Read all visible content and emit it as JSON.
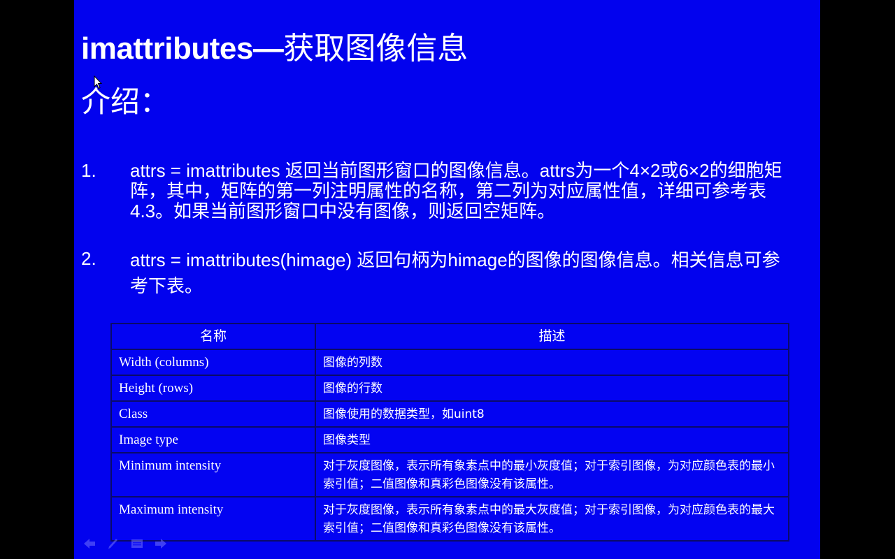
{
  "slide": {
    "title_en": "imattributes",
    "title_dash": "—",
    "title_zh": "获取图像信息",
    "subtitle": "介绍：",
    "items": [
      {
        "number": "1.",
        "code": "attrs = imattributes",
        "text": " 返回当前图形窗口的图像信息。attrs为一个4×2或6×2的细胞矩阵，其中，矩阵的第一列注明属性的名称，第二列为对应属性值，详细可参考表4.3。如果当前图形窗口中没有图像，则返回空矩阵。"
      },
      {
        "number": "2.",
        "code": "attrs = imattributes(himage)",
        "text": " 返回句柄为himage的图像的图像信息。相关信息可参考下表。"
      }
    ],
    "table": {
      "headers": [
        "名称",
        "描述"
      ],
      "rows": [
        {
          "name": "Width (columns)",
          "desc": "图像的列数"
        },
        {
          "name": "Height (rows)",
          "desc": "图像的行数"
        },
        {
          "name": "Class",
          "desc": "图像使用的数据类型，如uint8"
        },
        {
          "name": "Image type",
          "desc": "图像类型"
        },
        {
          "name": "Minimum intensity",
          "desc": "对于灰度图像，表示所有象素点中的最小灰度值；对于索引图像，为对应颜色表的最小索引值；二值图像和真彩色图像没有该属性。"
        },
        {
          "name": "Maximum intensity",
          "desc": "对于灰度图像，表示所有象素点中的最大灰度值；对于索引图像，为对应颜色表的最大索引值；二值图像和真彩色图像没有该属性。"
        }
      ]
    },
    "nav_icons": [
      "previous-slide-icon",
      "pen-icon",
      "slide-menu-icon",
      "next-slide-icon"
    ]
  },
  "colors": {
    "slide_background": "#0202ee",
    "text": "#ffffff",
    "table_border": "#0a0a6a",
    "letterbox": "#000000"
  }
}
